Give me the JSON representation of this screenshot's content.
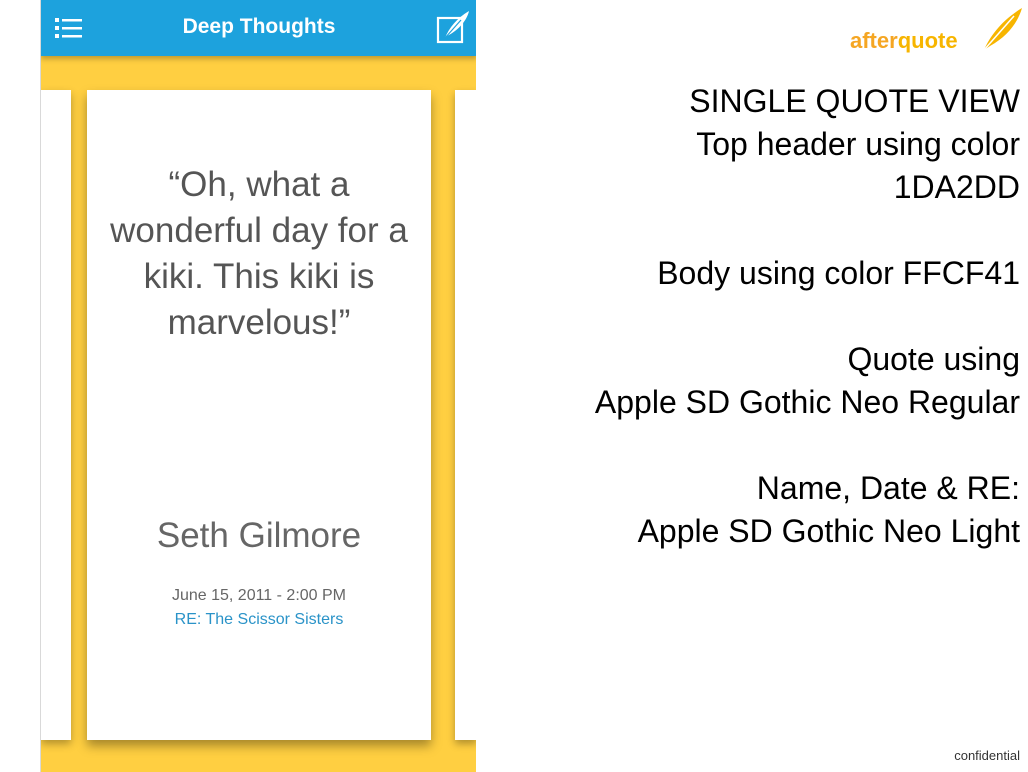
{
  "app": {
    "title": "Deep Thoughts",
    "menu_icon": "list-menu-icon",
    "compose_icon": "compose-quill-icon",
    "header_color": "#1DA2DD",
    "body_color": "#FFCF41"
  },
  "quote_card": {
    "quote": "“Oh, what a wonderful day for a kiki.  This kiki is marvelous!”",
    "author": "Seth Gilmore",
    "date": "June 15, 2011 - 2:00 PM",
    "re": "RE: The Scissor Sisters"
  },
  "logo": {
    "part1": "after",
    "part2": "quote"
  },
  "notes": {
    "line1": "SINGLE QUOTE VIEW",
    "line2": "Top header using color",
    "line3": "1DA2DD",
    "line4": "Body using color FFCF41",
    "line5": "Quote using",
    "line6": "Apple SD Gothic Neo Regular",
    "line7": "Name, Date & RE:",
    "line8": "Apple SD Gothic Neo Light"
  },
  "footer": {
    "confidential": "confidential"
  }
}
